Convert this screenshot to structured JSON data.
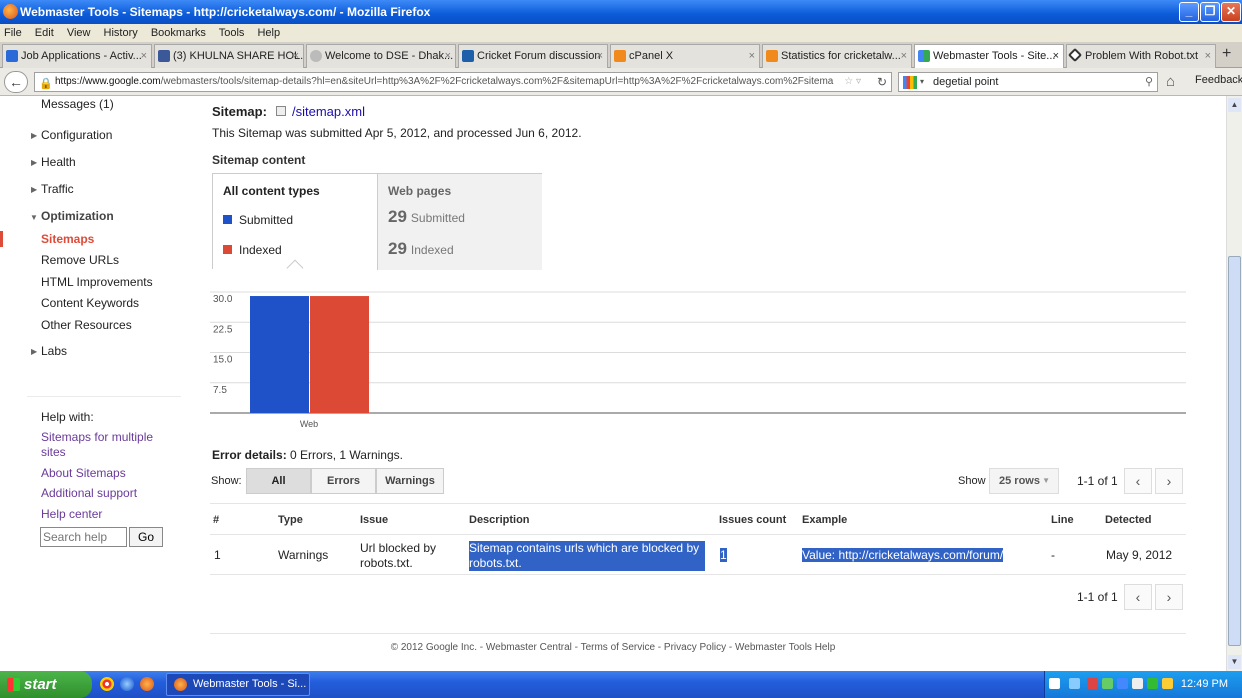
{
  "window": {
    "title": "Webmaster Tools - Sitemaps - http://cricketalways.com/ - Mozilla Firefox",
    "minimize": "_",
    "maximize": "❐",
    "close": "✕"
  },
  "menu": [
    "File",
    "Edit",
    "View",
    "History",
    "Bookmarks",
    "Tools",
    "Help"
  ],
  "tabs": [
    {
      "label": "Job Applications - Activ...",
      "icon_color": "#2a6ad8"
    },
    {
      "label": "(3) KHULNA SHARE HOL...",
      "icon_color": "#3b5998"
    },
    {
      "label": "Welcome to DSE - Dhak...",
      "icon_color": "#999999"
    },
    {
      "label": "Cricket Forum discussion",
      "icon_color": "#1d5fa8"
    },
    {
      "label": "cPanel X",
      "icon_color": "#f08a1c"
    },
    {
      "label": "Statistics for cricketalw...",
      "icon_color": "#f08a1c"
    },
    {
      "label": "Webmaster Tools - Site...",
      "icon_color": "#4285f4"
    },
    {
      "label": "Problem With Robot.txt",
      "icon_color": "#333333"
    }
  ],
  "tab_close": "×",
  "new_tab": "+",
  "nav": {
    "url_host": "https://www.google.com",
    "url_rest": "/webmasters/tools/sitemap-details?hl=en&siteUrl=http%3A%2F%2Fcricketalways.com%2F&sitemapUrl=http%3A%2F%2Fcricketalways.com%2Fsitema",
    "search_value": "degetial point",
    "feedback": "Feedback"
  },
  "sidebar": {
    "messages": "Messages (1)",
    "configuration": "Configuration",
    "health": "Health",
    "traffic": "Traffic",
    "optimization": "Optimization",
    "sitemaps": "Sitemaps",
    "remove_urls": "Remove URLs",
    "html_improvements": "HTML Improvements",
    "content_keywords": "Content Keywords",
    "other_resources": "Other Resources",
    "labs": "Labs",
    "help_with": "Help with:",
    "help_links": [
      "Sitemaps for multiple sites",
      "About Sitemaps",
      "Additional support",
      "Help center"
    ],
    "search_placeholder": "Search help",
    "go": "Go"
  },
  "main": {
    "sitemap_label": "Sitemap:",
    "sitemap_link": "/sitemap.xml",
    "submitted_text": "This Sitemap was submitted Apr 5, 2012, and processed Jun 6, 2012.",
    "content_heading": "Sitemap content",
    "all_types": "All content types",
    "submitted": "Submitted",
    "indexed": "Indexed",
    "web_pages": "Web pages",
    "submitted_count": "29",
    "indexed_count": "29",
    "submitted_color": "#1f52c8",
    "indexed_color": "#dc4a35"
  },
  "chart_data": {
    "type": "bar",
    "categories": [
      "Web"
    ],
    "series": [
      {
        "name": "Submitted",
        "values": [
          29
        ],
        "color": "#1f52c8"
      },
      {
        "name": "Indexed",
        "values": [
          29
        ],
        "color": "#dc4a35"
      }
    ],
    "yticks": [
      "30.0",
      "22.5",
      "15.0",
      "7.5"
    ],
    "ylim": [
      0,
      30
    ],
    "grid": true
  },
  "errors": {
    "label": "Error details:",
    "summary": "0 Errors, 1 Warnings.",
    "show": "Show:",
    "filters": [
      "All",
      "Errors",
      "Warnings"
    ],
    "show_rows_label": "Show",
    "rows_value": "25 rows",
    "pagination": "1-1 of 1",
    "prev": "‹",
    "next": "›",
    "columns": [
      "#",
      "Type",
      "Issue",
      "Description",
      "Issues count",
      "Example",
      "Line",
      "Detected"
    ],
    "rows": [
      {
        "num": "1",
        "type": "Warnings",
        "issue": "Url blocked by robots.txt.",
        "description": "Sitemap contains urls which are blocked by robots.txt.",
        "count": "1",
        "example": "Value: http://cricketalways.com/forum/",
        "line": "-",
        "detected": "May 9, 2012"
      }
    ]
  },
  "footer": "© 2012 Google Inc. - Webmaster Central - Terms of Service - Privacy Policy - Webmaster Tools Help",
  "taskbar": {
    "start": "start",
    "item": "Webmaster Tools - Si...",
    "clock": "12:49 PM"
  }
}
